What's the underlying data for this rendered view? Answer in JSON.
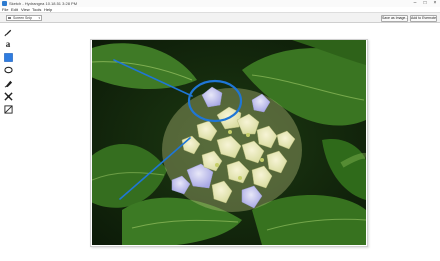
{
  "window": {
    "title": "Sketch - Hydrangea 10.18.51 3:28 PM",
    "minimize_glyph": "–",
    "maximize_glyph": "□",
    "close_glyph": "×"
  },
  "menu": {
    "items": [
      {
        "label": "File"
      },
      {
        "label": "Edit"
      },
      {
        "label": "View"
      },
      {
        "label": "Tools"
      },
      {
        "label": "Help"
      }
    ]
  },
  "toolbar": {
    "mode_select_value": "Screen Snip",
    "save_as_image_label": "Save as Image...",
    "add_to_evernote_label": "Add to Evernote"
  },
  "tools": [
    {
      "name": "pen-tool",
      "icon": "pen-icon"
    },
    {
      "name": "text-tool",
      "icon": "text-a-icon",
      "glyph": "a"
    },
    {
      "name": "rectangle-tool",
      "icon": "filled-square-icon",
      "color": "#2f7ce0"
    },
    {
      "name": "ellipse-tool",
      "icon": "ellipse-icon"
    },
    {
      "name": "highlighter-tool",
      "icon": "marker-icon"
    },
    {
      "name": "arrow-tool",
      "icon": "arrows-icon"
    },
    {
      "name": "crop-tool",
      "icon": "crop-icon"
    }
  ],
  "annotation": {
    "color": "#1f76d6"
  }
}
